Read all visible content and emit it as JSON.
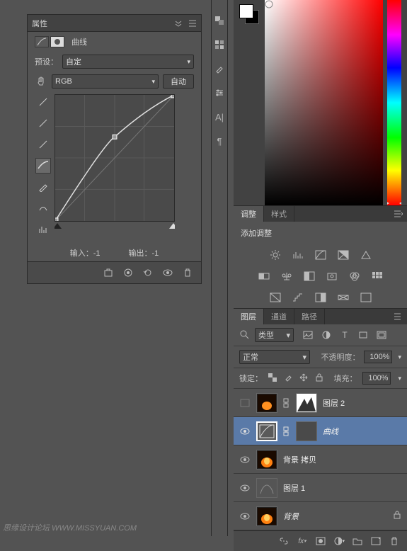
{
  "properties_panel": {
    "title": "属性",
    "type_label": "曲线",
    "preset_label": "预设：",
    "preset_value": "自定",
    "channel": "RGB",
    "auto_btn": "自动",
    "input_label": "输入：",
    "input_value": "-1",
    "output_label": "输出：",
    "output_value": "-1"
  },
  "tabs": {
    "adjustments": "调整",
    "styles": "样式"
  },
  "adjustments": {
    "title": "添加调整"
  },
  "layers_tabs": {
    "layers": "图层",
    "channels": "通道",
    "paths": "路径"
  },
  "layers_panel": {
    "kind_label": "类型",
    "blend_mode": "正常",
    "opacity_label": "不透明度：",
    "opacity_value": "100%",
    "lock_label": "锁定：",
    "fill_label": "填充：",
    "fill_value": "100%"
  },
  "layers": [
    {
      "name": "图层 2",
      "visible": false,
      "italic": false
    },
    {
      "name": "曲线",
      "visible": true,
      "italic": true,
      "selected": true
    },
    {
      "name": "背景 拷贝",
      "visible": true,
      "italic": false
    },
    {
      "name": "图层 1",
      "visible": true,
      "italic": false
    },
    {
      "name": "背景",
      "visible": true,
      "italic": true,
      "locked": true
    }
  ],
  "chart_data": {
    "type": "line",
    "title": "曲线",
    "xlabel": "输入",
    "ylabel": "输出",
    "xlim": [
      0,
      255
    ],
    "ylim": [
      0,
      255
    ],
    "series": [
      {
        "name": "curve",
        "x": [
          0,
          128,
          255
        ],
        "y": [
          0,
          170,
          255
        ]
      },
      {
        "name": "baseline",
        "x": [
          0,
          255
        ],
        "y": [
          0,
          255
        ]
      }
    ]
  },
  "watermark": "思缘设计论坛 WWW.MISSYUAN.COM"
}
